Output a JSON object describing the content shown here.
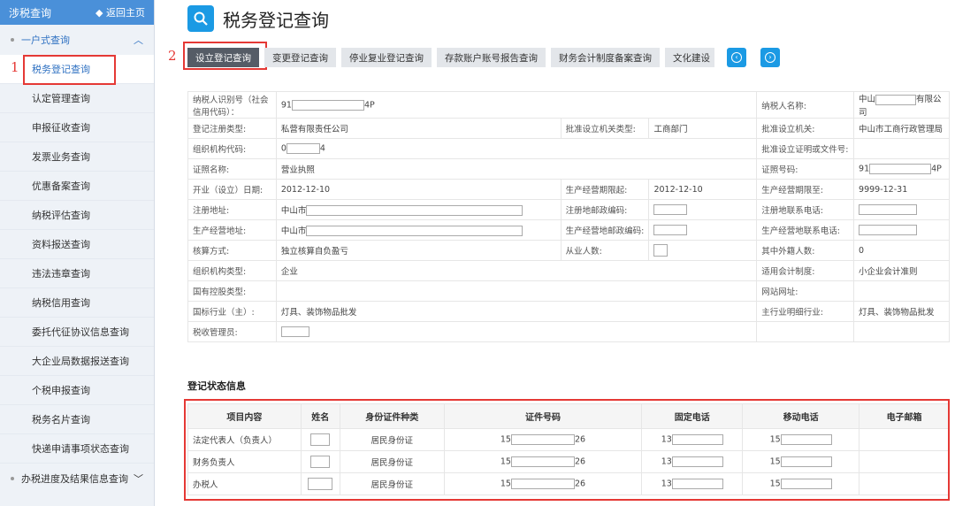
{
  "sidebar": {
    "title": "涉税查询",
    "back": "返回主页",
    "group1": "一户式查询",
    "items": [
      "税务登记查询",
      "认定管理查询",
      "申报征收查询",
      "发票业务查询",
      "优惠备案查询",
      "纳税评估查询",
      "资料报送查询",
      "违法违章查询",
      "纳税信用查询",
      "委托代征协议信息查询",
      "大企业局数据报送查询",
      "个税申报查询",
      "税务名片查询",
      "快递申请事项状态查询"
    ],
    "group2": "办税进度及结果信息查询"
  },
  "markers": {
    "m1": "1",
    "m2": "2"
  },
  "page": {
    "title": "税务登记查询"
  },
  "tabs": [
    "设立登记查询",
    "变更登记查询",
    "停业复业登记查询",
    "存款账户账号报告查询",
    "财务会计制度备案查询",
    "文化建设"
  ],
  "info": {
    "r1": {
      "l1": "纳税人识别号（社会信用代码）：",
      "v1a": "91",
      "v1b": "4P",
      "l2": "纳税人名称:",
      "v2a": "中山",
      "v2b": "有限公司"
    },
    "r2": {
      "l1": "登记注册类型:",
      "v1": "私营有限责任公司",
      "l2": "批准设立机关类型:",
      "v2": "工商部门",
      "l3": "批准设立机关:",
      "v3": "中山市工商行政管理局"
    },
    "r3": {
      "l1": "组织机构代码:",
      "v1a": "0",
      "v1b": "4",
      "l2": "批准设立证明或文件号:"
    },
    "r4": {
      "l1": "证照名称:",
      "v1": "营业执照",
      "l2": "证照号码:",
      "v2a": "91",
      "v2b": "4P"
    },
    "r5": {
      "l1": "开业（设立）日期:",
      "v1": "2012-12-10",
      "l2": "生产经营期限起:",
      "v2": "2012-12-10",
      "l3": "生产经营期限至:",
      "v3": "9999-12-31"
    },
    "r6": {
      "l1": "注册地址:",
      "v1": "中山市",
      "l2": "注册地邮政编码:",
      "l3": "注册地联系电话:"
    },
    "r7": {
      "l1": "生产经营地址:",
      "v1": "中山市",
      "l2": "生产经营地邮政编码:",
      "l3": "生产经营地联系电话:"
    },
    "r8": {
      "l1": "核算方式:",
      "v1": "独立核算自负盈亏",
      "l2": "从业人数:",
      "l3": "其中外籍人数:",
      "v3": "0"
    },
    "r9": {
      "l1": "组织机构类型:",
      "v1": "企业",
      "l2": "适用会计制度:",
      "v2": "小企业会计准则"
    },
    "r10": {
      "l1": "国有控股类型:",
      "l2": "网站网址:"
    },
    "r11": {
      "l1": "国标行业（主）:",
      "v1": "灯具、装饰物品批发",
      "l2": "主行业明细行业:",
      "v2": "灯具、装饰物品批发"
    },
    "r12": {
      "l1": "税收管理员:"
    }
  },
  "section": "登记状态信息",
  "status": {
    "headers": [
      "项目内容",
      "姓名",
      "身份证件种类",
      "证件号码",
      "固定电话",
      "移动电话",
      "电子邮箱"
    ],
    "rows": [
      {
        "item": "法定代表人（负责人）",
        "idtype": "居民身份证",
        "ida": "15",
        "idb": "26",
        "tel": "13",
        "mob": "15"
      },
      {
        "item": "财务负责人",
        "idtype": "居民身份证",
        "ida": "15",
        "idb": "26",
        "tel": "13",
        "mob": "15"
      },
      {
        "item": "办税人",
        "idtype": "居民身份证",
        "ida": "15",
        "idb": "26",
        "tel": "13",
        "mob": "15"
      }
    ]
  }
}
